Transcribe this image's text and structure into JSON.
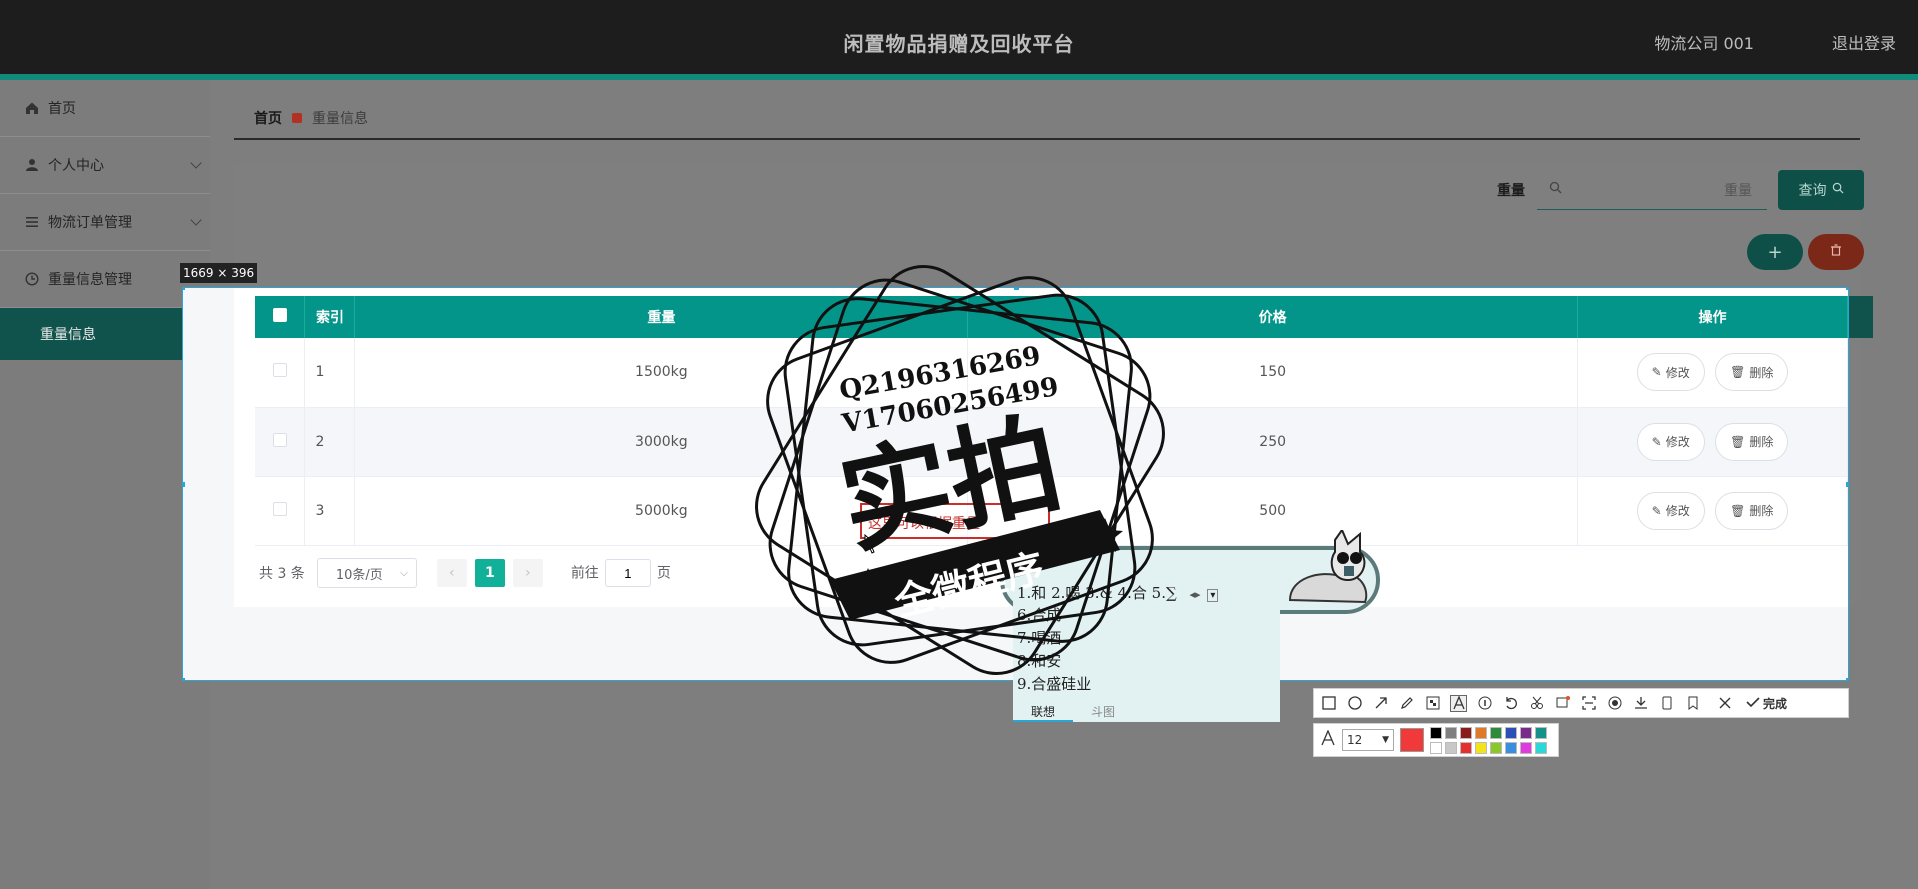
{
  "header": {
    "title": "闲置物品捐赠及回收平台",
    "user": "物流公司 001",
    "logout": "退出登录"
  },
  "sidebar": {
    "items": [
      {
        "label": "首页"
      },
      {
        "label": "个人中心"
      },
      {
        "label": "物流订单管理"
      },
      {
        "label": "重量信息管理"
      }
    ],
    "sub_item": "重量信息"
  },
  "breadcrumb": {
    "home": "首页",
    "current": "重量信息"
  },
  "search": {
    "label": "重量",
    "placeholder": "重量",
    "button": "查询"
  },
  "table": {
    "columns": [
      "索引",
      "重量",
      "价格",
      "操作"
    ],
    "rows": [
      {
        "index": "1",
        "weight": "1500kg",
        "price": "150"
      },
      {
        "index": "2",
        "weight": "3000kg",
        "price": "250"
      },
      {
        "index": "3",
        "weight": "5000kg",
        "price": "500"
      }
    ],
    "edit_label": "修改",
    "delete_label": "删除"
  },
  "pager": {
    "total": "共 3 条",
    "size": "10条/页",
    "current": "1",
    "goto_prefix": "前往",
    "goto_value": "1",
    "goto_suffix": "页"
  },
  "capture": {
    "size": "1669 × 396"
  },
  "annotation_text": "这里可以根据重量",
  "watermark": {
    "line1": "Q2196316269",
    "line2": "V17060256499",
    "big": "实拍",
    "banner": "全微程序"
  },
  "ime": {
    "row1": "1.和  2.喝  3.&  4.合  5.∑",
    "candidates": [
      "6.合成",
      "7.喝酒",
      "8.和安",
      "9.合盛硅业"
    ],
    "tabs": [
      "联想",
      "斗图"
    ]
  },
  "toolbar": {
    "done": "完成",
    "font_size": "12"
  },
  "colors": {
    "accent": "#04958a",
    "danger": "#c9302c",
    "sidebar_active": "#0f534c"
  }
}
